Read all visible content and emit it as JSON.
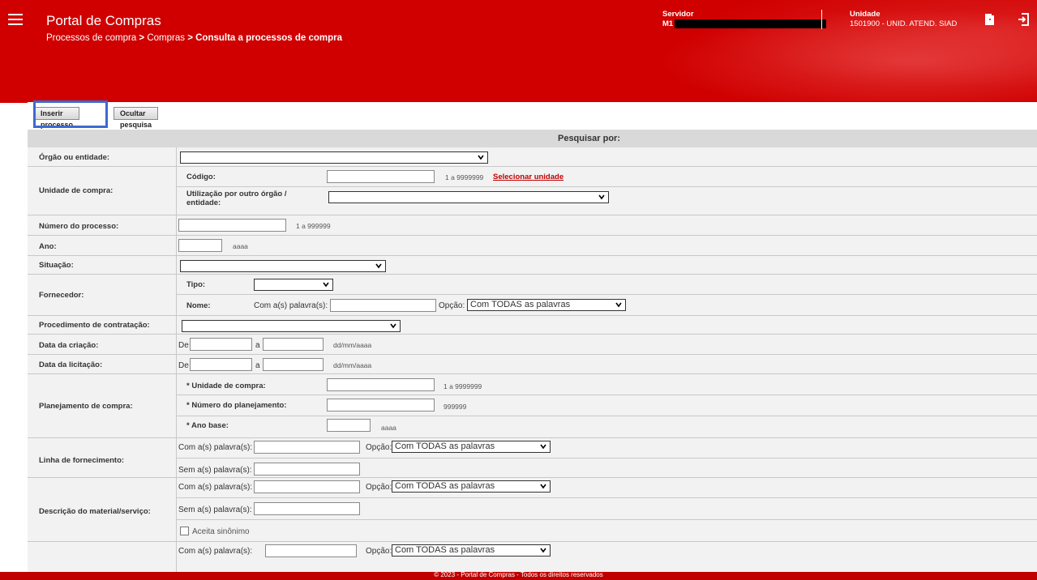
{
  "header": {
    "app_title": "Portal de Compras",
    "breadcrumb": [
      "Processos de compra",
      "Compras",
      "Consulta a processos de compra"
    ],
    "breadcrumb_sep": ">",
    "servidor_label": "Servidor",
    "servidor_value": "M1",
    "unidade_label": "Unidade",
    "unidade_value": "1501900 - UNID. ATEND. SIAD",
    "icons": [
      "menu-icon",
      "door-icon",
      "logout-icon"
    ]
  },
  "toolbar": {
    "insert_label": "Inserir processo",
    "hide_label": "Ocultar pesquisa"
  },
  "form": {
    "header": "Pesquisar por:",
    "orgao_label": "Órgão ou entidade:",
    "unidade_compra_label": "Unidade de compra:",
    "codigo_label": "Código:",
    "codigo_hint": "1 a 9999999",
    "selecionar_unidade": "Selecionar unidade",
    "utilizacao_label": "Utilização por outro órgão / entidade:",
    "numero_processo_label": "Número do processo:",
    "numero_processo_hint": "1 a 999999",
    "ano_label": "Ano:",
    "ano_hint": "aaaa",
    "situacao_label": "Situação:",
    "fornecedor_label": "Fornecedor:",
    "tipo_label": "Tipo:",
    "nome_label": "Nome:",
    "com_palavras": "Com a(s) palavra(s):",
    "sem_palavras": "Sem a(s) palavra(s):",
    "opcao_label": "Opção:",
    "opcao_value": "Com TODAS as palavras",
    "procedimento_label": "Procedimento de contratação:",
    "data_criacao_label": "Data da criação:",
    "data_licitacao_label": "Data da licitação:",
    "de": "De",
    "a": "a",
    "date_hint": "dd/mm/aaaa",
    "planejamento_label": "Planejamento de compra:",
    "plan_unidade_label": "* Unidade de compra:",
    "plan_unidade_hint": "1 a 9999999",
    "plan_numero_label": "* Número do planejamento:",
    "plan_numero_hint": "999999",
    "plan_ano_label": "* Ano base:",
    "plan_ano_hint": "aaaa",
    "linha_label": "Linha de fornecimento:",
    "descricao_label": "Descrição do material/serviço:",
    "aceita_sinonimo": "Aceita sinônimo"
  },
  "footer": {
    "text": "© 2023 - Portal de Compras - Todos os direitos reservados"
  },
  "colors": {
    "brand_red": "#d00000",
    "highlight_blue": "#3c6ad0"
  }
}
